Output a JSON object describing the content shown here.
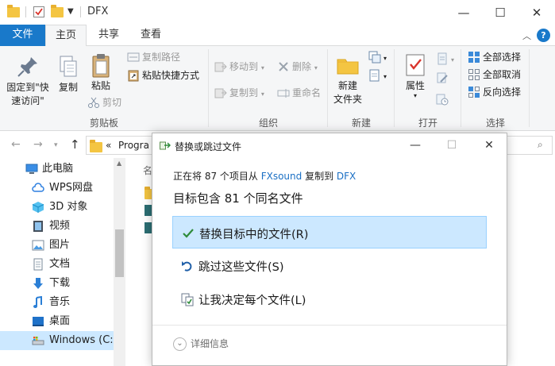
{
  "window": {
    "title": "DFX",
    "minimize_glyph": "—",
    "maximize_glyph": "☐",
    "close_glyph": "✕"
  },
  "ribbon_tabs": {
    "file": "文件",
    "home": "主页",
    "share": "共享",
    "view": "查看",
    "help_glyph": "?"
  },
  "ribbon": {
    "clipboard": {
      "pin_line1": "固定到\"快",
      "pin_line2": "速访问\"",
      "copy": "复制",
      "paste": "粘贴",
      "copy_path": "复制路径",
      "paste_shortcut": "粘贴快捷方式",
      "cut": "剪切",
      "label": "剪贴板"
    },
    "organize": {
      "move_to": "移动到",
      "delete": "删除",
      "copy_to": "复制到",
      "rename": "重命名",
      "label": "组织"
    },
    "new": {
      "new_folder_line1": "新建",
      "new_folder_line2": "文件夹",
      "label": "新建"
    },
    "open": {
      "properties": "属性",
      "label": "打开"
    },
    "select": {
      "select_all": "全部选择",
      "select_none": "全部取消",
      "invert": "反向选择",
      "label": "选择"
    }
  },
  "address_bar": {
    "back": "←",
    "forward": "→",
    "up": "↑",
    "path_prefix": "«",
    "path_first": "Progra"
  },
  "nav_pane": {
    "items": [
      {
        "label": "此电脑",
        "icon": "computer-icon"
      },
      {
        "label": "WPS网盘",
        "icon": "cloud-icon"
      },
      {
        "label": "3D 对象",
        "icon": "cube-icon"
      },
      {
        "label": "视频",
        "icon": "video-icon"
      },
      {
        "label": "图片",
        "icon": "picture-icon"
      },
      {
        "label": "文档",
        "icon": "document-icon"
      },
      {
        "label": "下载",
        "icon": "download-icon"
      },
      {
        "label": "音乐",
        "icon": "music-icon"
      },
      {
        "label": "桌面",
        "icon": "desktop-icon"
      },
      {
        "label": "Windows (C:)",
        "icon": "drive-icon"
      }
    ],
    "selected_index": 9
  },
  "content": {
    "column_header": "名"
  },
  "dialog": {
    "title": "替换或跳过文件",
    "status_prefix": "正在将 87 个项目从 ",
    "source": "FXsound",
    "status_middle": " 复制到 ",
    "destination": "DFX",
    "heading": "目标包含 81 个同名文件",
    "options": [
      {
        "label": "替换目标中的文件(R)",
        "icon": "checkmark-icon"
      },
      {
        "label": "跳过这些文件(S)",
        "icon": "skip-icon"
      },
      {
        "label": "让我决定每个文件(L)",
        "icon": "decide-icon"
      }
    ],
    "details": "详细信息",
    "details_glyph": "⌄",
    "colors": {
      "accent": "#1a6fc4",
      "selected_bg": "#cce8ff",
      "check": "#2e8b3a"
    }
  }
}
